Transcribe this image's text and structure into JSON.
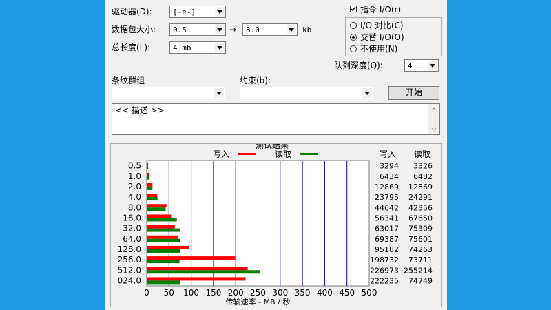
{
  "controls": {
    "drive": {
      "label": "驱动器(D):",
      "value": "[-e-]"
    },
    "transfer_size": {
      "label": "数据包大小:",
      "from_value": "0.5",
      "arrow": "→",
      "to_value": "8.0",
      "unit": "kb"
    },
    "total_length": {
      "label": "总长度(L):",
      "value": "4 mb"
    },
    "direct_io": {
      "label": "指令 I/O(r)",
      "checked": true
    },
    "io_mode": {
      "options": [
        {
          "label": "I/O 对比(C)",
          "selected": false
        },
        {
          "label": "交替 I/O(O)",
          "selected": true
        },
        {
          "label": "不使用(N)",
          "selected": false
        }
      ]
    },
    "queue_depth": {
      "label": "队列深度(Q):",
      "value": "4"
    },
    "stripe_group": {
      "label": "条纹群组",
      "value": ""
    },
    "constraint": {
      "label": "约束(b):",
      "value": ""
    },
    "start_button": {
      "label": "开始"
    },
    "description": {
      "text": "<< 描述 >>"
    }
  },
  "results": {
    "group_title": "测试结果",
    "legend_write": "写入",
    "legend_read": "读取",
    "col_write": "写入",
    "col_read": "读取",
    "rows": [
      {
        "size": "0.5",
        "write": "3294",
        "read": "3326"
      },
      {
        "size": "1.0",
        "write": "6434",
        "read": "6482"
      },
      {
        "size": "2.0",
        "write": "12869",
        "read": "12869"
      },
      {
        "size": "4.0",
        "write": "23795",
        "read": "24291"
      },
      {
        "size": "8.0",
        "write": "44642",
        "read": "42356"
      },
      {
        "size": "16.0",
        "write": "56341",
        "read": "67650"
      },
      {
        "size": "32.0",
        "write": "63017",
        "read": "75309"
      },
      {
        "size": "64.0",
        "write": "69387",
        "read": "75601"
      },
      {
        "size": "128.0",
        "write": "95182",
        "read": "74263"
      },
      {
        "size": "256.0",
        "write": "198732",
        "read": "73711"
      },
      {
        "size": "512.0",
        "write": "226973",
        "read": "255214"
      },
      {
        "size": "024.0",
        "write": "222235",
        "read": "74749"
      }
    ]
  },
  "chart_data": {
    "type": "bar",
    "orientation": "horizontal",
    "categories": [
      "0.5",
      "1.0",
      "2.0",
      "4.0",
      "8.0",
      "16.0",
      "32.0",
      "64.0",
      "128.0",
      "256.0",
      "512.0",
      "024.0"
    ],
    "series": [
      {
        "name": "写入",
        "color": "#ff0000",
        "values": [
          3.3,
          6.4,
          12.9,
          23.8,
          44.6,
          56.3,
          63.0,
          69.4,
          95.2,
          198.7,
          227.0,
          222.2
        ]
      },
      {
        "name": "读取",
        "color": "#008000",
        "values": [
          3.3,
          6.5,
          12.9,
          24.3,
          42.4,
          67.7,
          75.3,
          75.6,
          74.3,
          73.7,
          255.2,
          74.7
        ]
      }
    ],
    "xticks": [
      "0",
      "50",
      "100",
      "150",
      "200",
      "250",
      "300",
      "350",
      "400",
      "450",
      "500"
    ],
    "xlim": [
      0,
      500
    ],
    "xlabel": "传输速率 - MB / 秒",
    "grid": true,
    "legend_position": "top"
  }
}
